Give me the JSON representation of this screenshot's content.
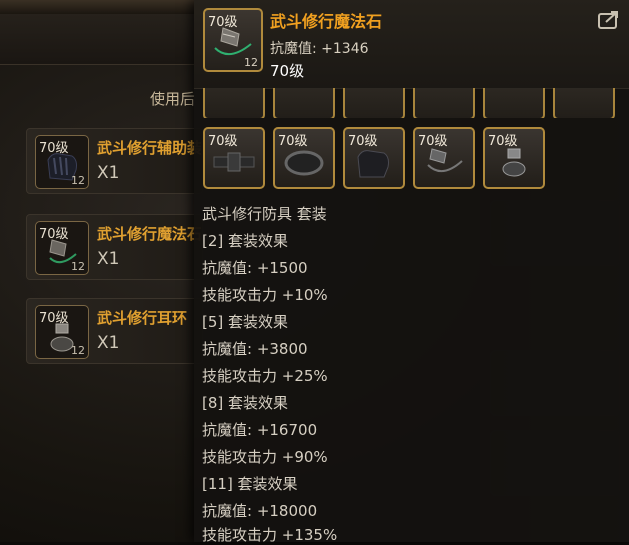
{
  "background": {
    "hint": "使用后",
    "items": [
      {
        "level": "70级",
        "count": "12",
        "name": "武斗修行辅助装备",
        "qty": "X1",
        "icon": "gloves-icon"
      },
      {
        "level": "70级",
        "count": "12",
        "name": "武斗修行魔法石",
        "qty": "X1",
        "icon": "magic-stone-icon"
      },
      {
        "level": "70级",
        "count": "12",
        "name": "武斗修行耳环",
        "qty": "X1",
        "icon": "earring-icon"
      }
    ]
  },
  "tooltip": {
    "icon": {
      "level": "70级",
      "count": "12",
      "name": "magic-stone-icon"
    },
    "title": "武斗修行魔法石",
    "stat": "抗魔值: +1346",
    "level": "70级",
    "share_icon": "share-icon",
    "set_items": [
      {
        "level": "70级",
        "icon": "belt-icon"
      },
      {
        "level": "70级",
        "icon": "bracelet-icon"
      },
      {
        "level": "70级",
        "icon": "gloves-icon"
      },
      {
        "level": "70级",
        "icon": "magic-stone-icon"
      },
      {
        "level": "70级",
        "icon": "earring-icon"
      }
    ],
    "set_lines": [
      "武斗修行防具 套装",
      "[2] 套装效果",
      "抗魔值: +1500",
      "技能攻击力 +10%",
      "[5] 套装效果",
      "抗魔值: +3800",
      "技能攻击力 +25%",
      "[8] 套装效果",
      "抗魔值: +16700",
      "技能攻击力 +90%",
      "[11] 套装效果",
      "抗魔值: +18000",
      "技能攻击力 +135%"
    ]
  },
  "colors": {
    "item_name": "#e0a030",
    "title": "#f0a020",
    "slot_border": "#b08a3c"
  }
}
